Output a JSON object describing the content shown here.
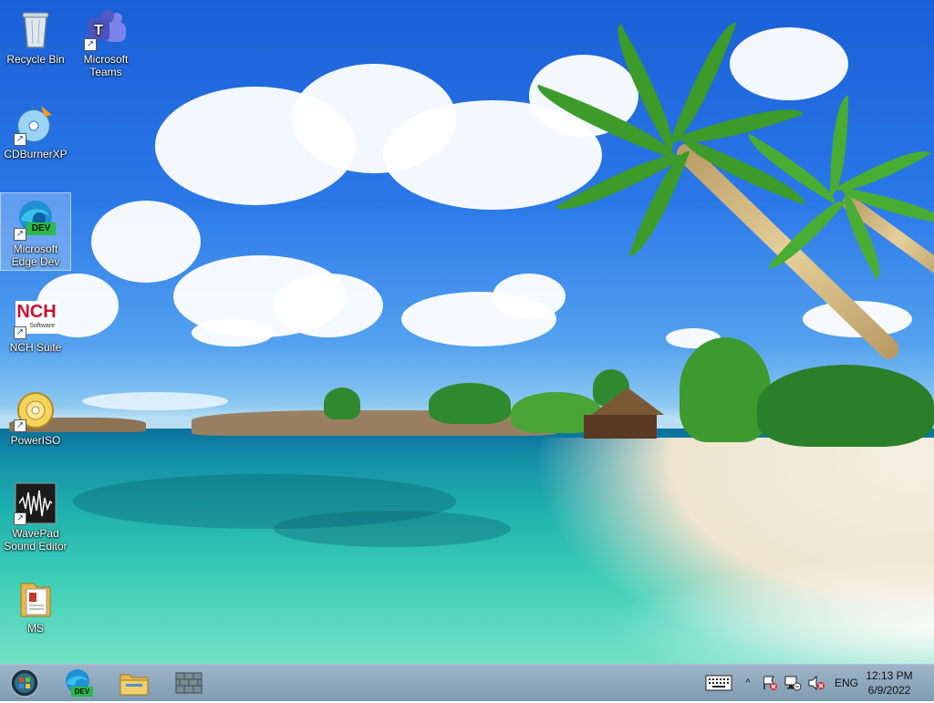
{
  "desktop_icons": [
    {
      "label": "Recycle Bin",
      "icon": "recycle-bin-icon"
    },
    {
      "label": "Microsoft\nTeams",
      "icon": "teams-icon"
    },
    {
      "label": "CDBurnerXP",
      "icon": "cdburnerxp-icon"
    },
    {
      "label": "Microsoft\nEdge Dev",
      "icon": "edge-dev-icon",
      "badge": "DEV"
    },
    {
      "label": "NCH Suite",
      "icon": "nch-suite-icon",
      "logo_text": "NCH",
      "logo_sub": "Software"
    },
    {
      "label": "PowerISO",
      "icon": "poweriso-icon"
    },
    {
      "label": "WavePad\nSound Editor",
      "icon": "wavepad-icon"
    },
    {
      "label": "MS",
      "icon": "folder-icon"
    }
  ],
  "taskbar": {
    "pinned": [
      {
        "name": "start-button",
        "icon": "windows-orb-icon"
      },
      {
        "name": "edge-dev-taskbar",
        "icon": "edge-dev-icon",
        "badge": "DEV"
      },
      {
        "name": "file-explorer-taskbar",
        "icon": "file-explorer-icon"
      },
      {
        "name": "app-taskbar",
        "icon": "brick-wall-icon"
      }
    ],
    "tray": {
      "keyboard": "touch-keyboard-icon",
      "chevron": "^",
      "language": "ENG"
    },
    "clock": {
      "time": "12:13 PM",
      "date": "6/9/2022"
    }
  }
}
